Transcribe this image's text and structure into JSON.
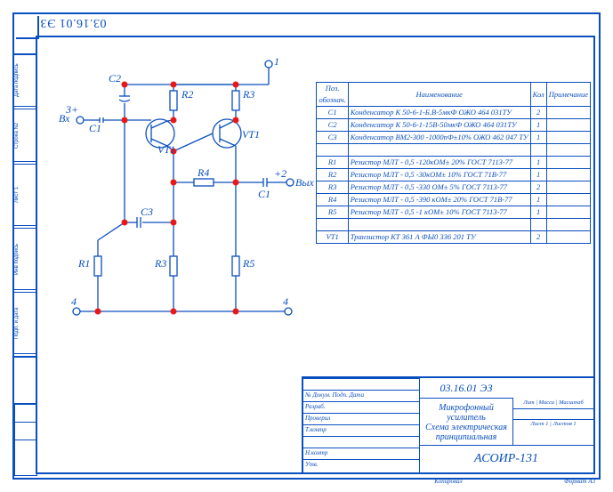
{
  "doc_code": "03.16.01 ЭЗ",
  "gost_cells": [
    "Дата подпись",
    "Строка N2",
    "Лист 1",
    "Инв подпись",
    "Подп. и дата"
  ],
  "schematic": {
    "terminals": {
      "in": "Вх",
      "out": "Вых",
      "plus": "3+",
      "n1": "1",
      "n2": "+2",
      "n4a": "4",
      "n4b": "4"
    },
    "labels": {
      "c1": "С1",
      "c1b": "С1",
      "c2": "С2",
      "c3": "С3",
      "r1": "R1",
      "r2": "R2",
      "r3": "R3",
      "r4": "R4",
      "r5": "R5",
      "vt1": "VT1",
      "vt1b": "VT1"
    }
  },
  "bom": {
    "head": {
      "pos": "Поз.\nобознач.",
      "name": "Наименование",
      "qty": "Кол",
      "note": "Примечание"
    },
    "rows": [
      {
        "pos": "С1",
        "name": "Конденсатор К 50-6-1-Б.В-5мкФ ОЖО 464 031ТУ",
        "qty": "2"
      },
      {
        "pos": "С2",
        "name": "Конденсатор К 50-6-1-15В-50мкФ ОЖО 464 031ТУ",
        "qty": "1"
      },
      {
        "pos": "С3",
        "name": "Конденсатор ВМ2-300 -1000пФ±10% ОЖО 462 047 ТУ",
        "qty": "1"
      },
      {
        "gap": true
      },
      {
        "pos": "R1",
        "name": "Резистор МЛТ - 0,5 -120кОМ± 20% ГОСТ 7113-77",
        "qty": "1"
      },
      {
        "pos": "R2",
        "name": "Резистор МЛТ - 0,5 -30кОМ± 10% ГОСТ 71В-77",
        "qty": "1"
      },
      {
        "pos": "R3",
        "name": "Резистор МЛТ - 0,5 -330 ОМ± 5% ГОСТ 7113-77",
        "qty": "2"
      },
      {
        "pos": "R4",
        "name": "Резистор МЛТ - 0,5 -390 кОМ± 20% ГОСТ 71В-77",
        "qty": "1"
      },
      {
        "pos": "R5",
        "name": "Резистор МЛТ - 0,5 -1 кОМ± 10% ГОСТ 7113-77",
        "qty": "1"
      },
      {
        "gap": true
      },
      {
        "pos": "VT1",
        "name": "Транзистор КТ 361 А ФЫ0 336 201 ТУ",
        "qty": "2"
      }
    ]
  },
  "stamp": {
    "left_rows": [
      "",
      "№ Докум.   Подп.   Дата",
      "Разраб.",
      "Проверил",
      "Т.контр",
      "",
      "Н.контр",
      "Утв."
    ],
    "code": "03.16.01 ЭЗ",
    "title": "Микрофонный усилитель\nСхема электрическая\nпринципиальная",
    "project": "АСОИР-131",
    "rt_head": "Лит | Масса | Масштаб",
    "rt_sheet": "Лист 1 | Листов 1",
    "format": "Формат    А3",
    "copy": "Копировал"
  }
}
